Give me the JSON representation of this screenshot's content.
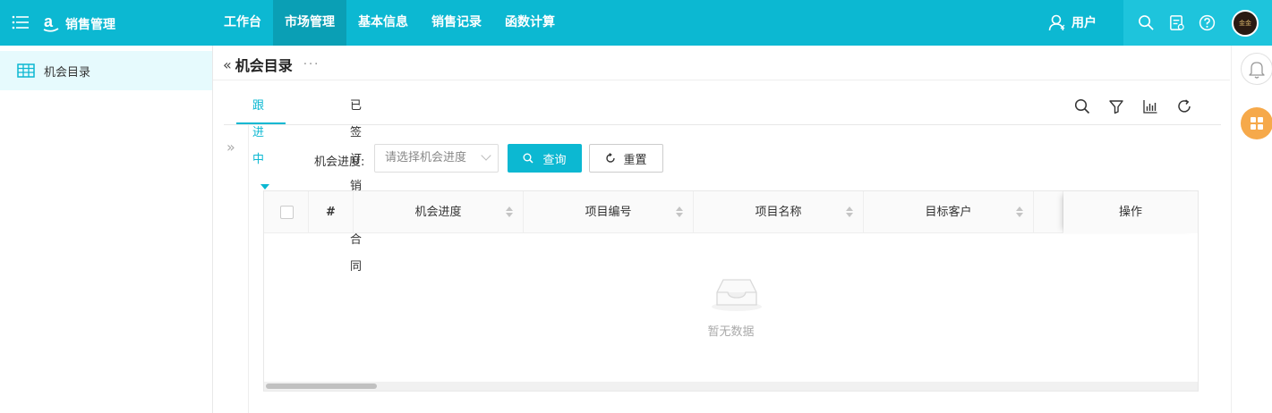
{
  "header": {
    "app_title": "销售管理",
    "nav": [
      {
        "label": "工作台",
        "active": false
      },
      {
        "label": "市场管理",
        "active": true
      },
      {
        "label": "基本信息",
        "active": false
      },
      {
        "label": "销售记录",
        "active": false
      },
      {
        "label": "函数计算",
        "active": false
      }
    ],
    "user_label": "用户",
    "avatar_text": "金金",
    "brand_color": "#0cb8d2"
  },
  "sidebar": {
    "items": [
      {
        "label": "机会目录",
        "icon": "table-icon"
      }
    ]
  },
  "page": {
    "title": "机会目录",
    "more": "···",
    "tabs": [
      {
        "label": "跟进中",
        "active": true
      },
      {
        "label": "已签订销售合同",
        "active": false
      }
    ]
  },
  "filter": {
    "label": "机会进度:",
    "select_placeholder": "请选择机会进度",
    "query_label": "查询",
    "reset_label": "重置"
  },
  "table": {
    "columns": [
      "#",
      "机会进度",
      "项目编号",
      "项目名称",
      "目标客户",
      "",
      "操作"
    ],
    "rows": [],
    "empty_text": "暂无数据"
  }
}
